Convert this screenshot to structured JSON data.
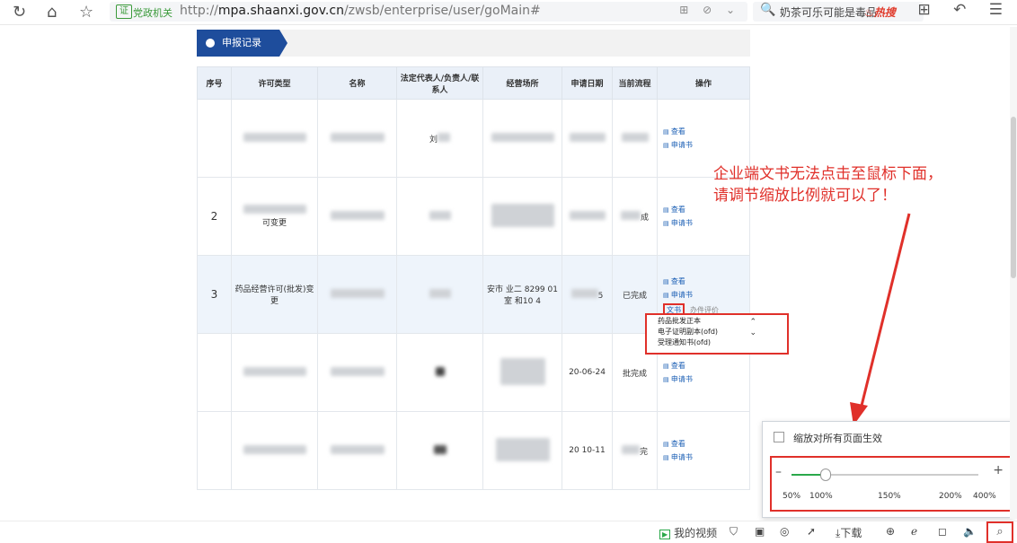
{
  "browser": {
    "nav_icons": [
      "back-icon",
      "home-icon",
      "star-icon"
    ],
    "secure_badge": "证",
    "secure_text": "党政机关",
    "url_prefix": "http://",
    "url_domain": "mpa.shaanxi.gov.cn",
    "url_path": "/zwsb/enterprise/user/goMain#",
    "search_text": "奶茶可乐可能是毒品",
    "hot_label": "热搜"
  },
  "section": {
    "title": "申报记录"
  },
  "table": {
    "headers": [
      "序号",
      "许可类型",
      "名称",
      "法定代表人/负责人/联系人",
      "经营场所",
      "申请日期",
      "当前流程",
      "操作"
    ],
    "rows": [
      {
        "seq": "",
        "type": "",
        "name": "",
        "rep": "刘",
        "addr": "",
        "date": "",
        "flow": "",
        "ops": [
          "查看",
          "申请书"
        ]
      },
      {
        "seq": "2",
        "type": "可变更",
        "name": "",
        "rep": "",
        "addr": "",
        "date": "",
        "flow": "成",
        "ops": [
          "查看",
          "申请书"
        ]
      },
      {
        "seq": "3",
        "type": "药品经营许可(批发)变更",
        "name": "",
        "rep": "",
        "addr": "安市 业二 8299 01室 和10 4",
        "date": "5",
        "flow": "已完成",
        "ops": [
          "查看",
          "申请书"
        ],
        "wenshu": "文书",
        "evaluate": "办件评价"
      },
      {
        "seq": "",
        "type": "",
        "name": "",
        "rep": "",
        "addr": "",
        "date": "20-06-24",
        "flow": "批完成",
        "ops": [
          "查看",
          "申请书"
        ]
      },
      {
        "seq": "",
        "type": "",
        "name": "",
        "rep": "",
        "addr": "",
        "date": "20 10-11",
        "flow": "完",
        "ops": [
          "查看",
          "申请书"
        ]
      }
    ]
  },
  "dropdown": {
    "options": [
      "药品批发正本",
      "电子证明副本(ofd)",
      "受理通知书(ofd)"
    ]
  },
  "annotation": {
    "line1": "企业端文书无法点击至鼠标下面，",
    "line2": "请调节缩放比例就可以了！"
  },
  "zoom_panel": {
    "apply_all_label": "缩放对所有页面生效",
    "minus": "–",
    "plus": "+",
    "ticks": [
      "50%",
      "100%",
      "150%",
      "200%",
      "400%"
    ],
    "current_zoom_percent": 100
  },
  "statusbar": {
    "video_label": "我的视频",
    "download_label": "下载"
  }
}
